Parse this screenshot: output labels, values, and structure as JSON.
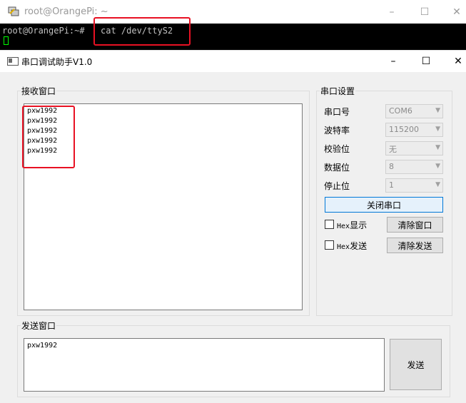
{
  "terminal": {
    "title": "root@OrangePi: ~",
    "prompt": "root@OrangePi:~#",
    "command": "cat /dev/ttyS2"
  },
  "dialog": {
    "title": "串口调试助手V1.0",
    "receive": {
      "label": "接收窗口",
      "lines": [
        "pxw1992",
        "pxw1992",
        "pxw1992",
        "pxw1992",
        "pxw1992"
      ]
    },
    "settings": {
      "label": "串口设置",
      "fields": [
        {
          "label": "串口号",
          "value": "COM6"
        },
        {
          "label": "波特率",
          "value": "115200"
        },
        {
          "label": "校验位",
          "value": "无"
        },
        {
          "label": "数据位",
          "value": "8"
        },
        {
          "label": "停止位",
          "value": "1"
        }
      ],
      "close_port_button": "关闭串口",
      "hex_display": {
        "prefix": "Hex",
        "text": "显示"
      },
      "hex_send": {
        "prefix": "Hex",
        "text": "发送"
      },
      "clear_window_button": "清除窗口",
      "clear_send_button": "清除发送"
    },
    "send": {
      "label": "发送窗口",
      "text": "pxw1992",
      "send_button": "发送"
    }
  },
  "colors": {
    "highlight": "#e81123",
    "terminal_bg": "#000000",
    "cursor": "#00ff00"
  }
}
